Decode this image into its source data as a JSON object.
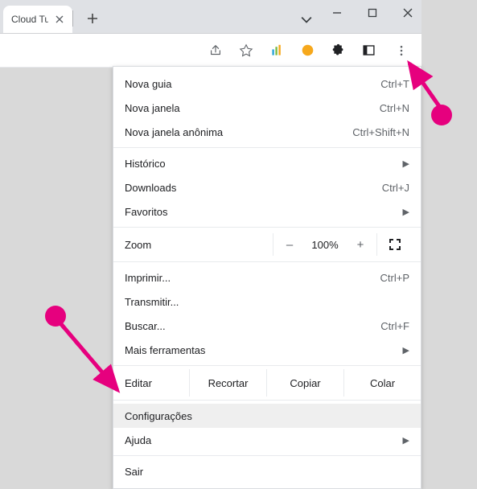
{
  "tab": {
    "title": "Cloud Tuto"
  },
  "menu": {
    "newTab": {
      "label": "Nova guia",
      "shortcut": "Ctrl+T"
    },
    "newWindow": {
      "label": "Nova janela",
      "shortcut": "Ctrl+N"
    },
    "incognito": {
      "label": "Nova janela anônima",
      "shortcut": "Ctrl+Shift+N"
    },
    "history": {
      "label": "Histórico"
    },
    "downloads": {
      "label": "Downloads",
      "shortcut": "Ctrl+J"
    },
    "bookmarks": {
      "label": "Favoritos"
    },
    "zoom": {
      "label": "Zoom",
      "minus": "–",
      "value": "100%",
      "plus": "+"
    },
    "print": {
      "label": "Imprimir...",
      "shortcut": "Ctrl+P"
    },
    "cast": {
      "label": "Transmitir..."
    },
    "find": {
      "label": "Buscar...",
      "shortcut": "Ctrl+F"
    },
    "moreTools": {
      "label": "Mais ferramentas"
    },
    "edit": {
      "label": "Editar",
      "cut": "Recortar",
      "copy": "Copiar",
      "paste": "Colar"
    },
    "settings": {
      "label": "Configurações"
    },
    "help": {
      "label": "Ajuda"
    },
    "exit": {
      "label": "Sair"
    }
  }
}
